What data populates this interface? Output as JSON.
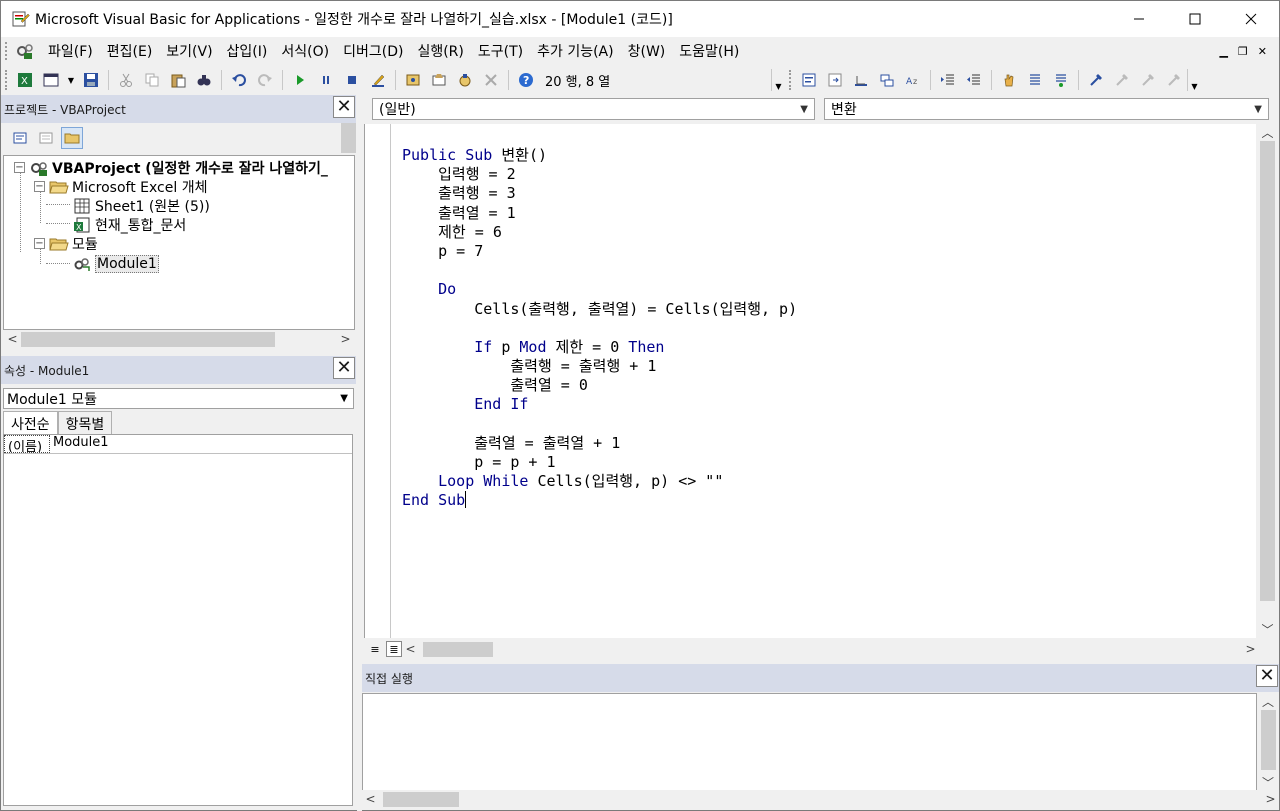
{
  "window": {
    "title": "Microsoft Visual Basic for Applications - 일정한 개수로 잘라 나열하기_실습.xlsx - [Module1 (코드)]",
    "minimize": "—",
    "maximize": "☐",
    "close": "✕"
  },
  "menu": {
    "items": [
      "파일(F)",
      "편집(E)",
      "보기(V)",
      "삽입(I)",
      "서식(O)",
      "디버그(D)",
      "실행(R)",
      "도구(T)",
      "추가 기능(A)",
      "창(W)",
      "도움말(H)"
    ]
  },
  "toolbar": {
    "position": "20 행, 8 열"
  },
  "project": {
    "header": "프로젝트 - VBAProject",
    "tree": {
      "root": "VBAProject (일정한 개수로 잘라 나열하기_",
      "excel_objects": "Microsoft Excel 개체",
      "sheet1": "Sheet1 (원본 (5))",
      "workbook": "현재_통합_문서",
      "modules": "모듈",
      "module1": "Module1"
    }
  },
  "properties": {
    "header": "속성 - Module1",
    "object_select": "Module1 모듈",
    "tabs": [
      "사전순",
      "항목별"
    ],
    "rows": [
      {
        "name": "(이름)",
        "value": "Module1"
      }
    ]
  },
  "code": {
    "object_combo": "(일반)",
    "procedure_combo": "변환",
    "lines": [
      [
        {
          "t": "Public Sub",
          "k": true
        },
        {
          "t": " 변환()"
        }
      ],
      [
        {
          "t": "    입력행 = 2"
        }
      ],
      [
        {
          "t": "    출력행 = 3"
        }
      ],
      [
        {
          "t": "    출력열 = 1"
        }
      ],
      [
        {
          "t": "    제한 = 6"
        }
      ],
      [
        {
          "t": "    p = 7"
        }
      ],
      [
        {
          "t": ""
        }
      ],
      [
        {
          "t": "    "
        },
        {
          "t": "Do",
          "k": true
        }
      ],
      [
        {
          "t": "        Cells(출력행, 출력열) = Cells(입력행, p)"
        }
      ],
      [
        {
          "t": ""
        }
      ],
      [
        {
          "t": "        "
        },
        {
          "t": "If",
          "k": true
        },
        {
          "t": " p "
        },
        {
          "t": "Mod",
          "k": true
        },
        {
          "t": " 제한 = 0 "
        },
        {
          "t": "Then",
          "k": true
        }
      ],
      [
        {
          "t": "            출력행 = 출력행 + 1"
        }
      ],
      [
        {
          "t": "            출력열 = 0"
        }
      ],
      [
        {
          "t": "        "
        },
        {
          "t": "End If",
          "k": true
        }
      ],
      [
        {
          "t": ""
        }
      ],
      [
        {
          "t": "        출력열 = 출력열 + 1"
        }
      ],
      [
        {
          "t": "        p = p + 1"
        }
      ],
      [
        {
          "t": "    "
        },
        {
          "t": "Loop While",
          "k": true
        },
        {
          "t": " Cells(입력행, p) <> \"\""
        }
      ],
      [
        {
          "t": "End Sub",
          "k": true
        }
      ]
    ]
  },
  "immediate": {
    "header": "직접 실행"
  },
  "colors": {
    "keyword": "#00008b",
    "panel_header": "#d6dbe9"
  }
}
